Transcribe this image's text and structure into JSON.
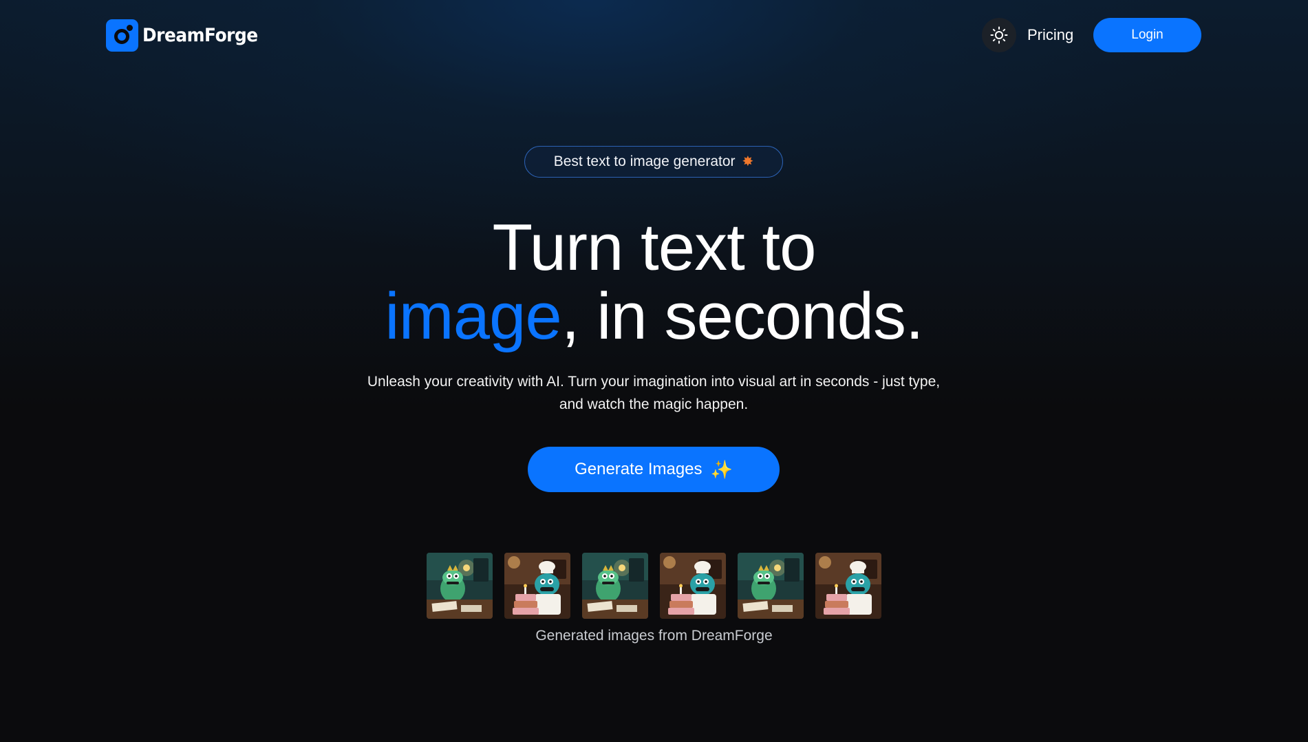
{
  "header": {
    "brand": "DreamForge",
    "theme_toggle_icon": "sun-icon",
    "nav_pricing": "Pricing",
    "login_label": "Login"
  },
  "hero": {
    "badge_text": "Best text to image generator",
    "badge_icon": "star-icon",
    "headline_line1": "Turn text to",
    "headline_accent": "image",
    "headline_rest": ", in seconds.",
    "subtitle": "Unleash your creativity with AI. Turn your imagination into visual art in seconds - just type, and watch the magic happen.",
    "cta_label": "Generate Images",
    "cta_icon": "sparkles-icon"
  },
  "gallery": {
    "thumbnails": [
      {
        "subject": "green monster at desk"
      },
      {
        "subject": "chef monster with cake"
      },
      {
        "subject": "green monster at desk"
      },
      {
        "subject": "chef monster with cake"
      },
      {
        "subject": "green monster at desk"
      },
      {
        "subject": "chef monster with cake"
      }
    ],
    "caption": "Generated images from DreamForge"
  },
  "colors": {
    "accent": "#0a74ff",
    "background": "#0b0b0d",
    "badge_star": "#f0782c",
    "sparkle": "#ffd23f"
  }
}
